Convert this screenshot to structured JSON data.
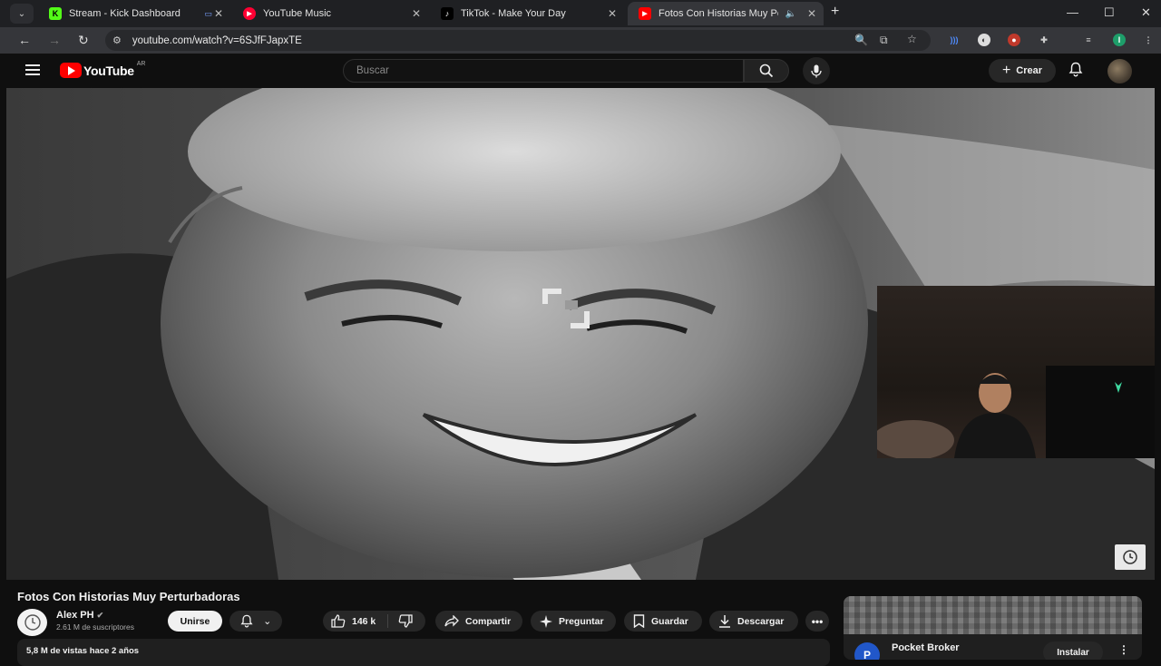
{
  "browser": {
    "tabs": [
      {
        "title": "Stream - Kick Dashboard",
        "favicon": "kick-icon"
      },
      {
        "title": "YouTube Music",
        "favicon": "youtube-music-icon"
      },
      {
        "title": "TikTok - Make Your Day",
        "favicon": "tiktok-icon"
      },
      {
        "title": "Fotos Con Historias Muy Pe",
        "favicon": "youtube-icon",
        "active": true
      }
    ],
    "url": "youtube.com/watch?v=6SJfFJapxTE",
    "profile_initial": "I"
  },
  "youtube": {
    "logo_text": "YouTube",
    "country": "AR",
    "search_placeholder": "Buscar",
    "create_label": "Crear"
  },
  "video": {
    "title": "Fotos Con Historias Muy Perturbadoras",
    "channel": "Alex PH",
    "subscribers": "2.61 M de suscriptores",
    "join_label": "Unirse",
    "likes": "146 k",
    "share_label": "Compartir",
    "ask_label": "Preguntar",
    "save_label": "Guardar",
    "download_label": "Descargar",
    "meta": "5,8 M de vistas  hace 2 años"
  },
  "ad": {
    "name": "Pocket Broker",
    "logo_letter": "P",
    "install_label": "Instalar"
  },
  "colors": {
    "accent": "#ff0000",
    "background": "#0f0f0f"
  }
}
